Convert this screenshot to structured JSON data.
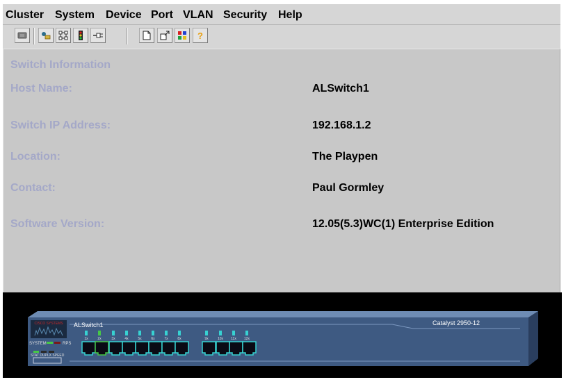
{
  "menu": [
    "Cluster",
    "System",
    "Device",
    "Port",
    "VLAN",
    "Security",
    "Help"
  ],
  "toolbar": {
    "icons": [
      "monitor-icon",
      "topology-icon",
      "network-icon",
      "traffic-light-icon",
      "cable-icon",
      "new-document-icon",
      "move-window-icon",
      "color-grid-icon",
      "help-icon"
    ]
  },
  "switch_info": {
    "title": "Switch Information",
    "host_name_label": "Host Name:",
    "host_name": "ALSwitch1",
    "ip_label": "Switch IP Address:",
    "ip": "192.168.1.2",
    "location_label": "Location:",
    "location": "The Playpen",
    "contact_label": "Contact:",
    "contact": "Paul Gormley",
    "version_label": "Software Version:",
    "version": "12.05(5.3)WC(1) Enterprise Edition"
  },
  "device": {
    "brand": "CISCO SYSTEMS",
    "host": "ALSwitch1",
    "model": "Catalyst 2950-12",
    "system_label": "SYSTEM",
    "rps_label": "RPS",
    "mode_labels": "STAT DUPLX SPEED",
    "port_labels": [
      "1x",
      "2x",
      "3x",
      "4x",
      "5x",
      "6x",
      "7x",
      "8x",
      "9x",
      "10x",
      "11x",
      "12x"
    ],
    "colors": {
      "port_led": "#37d2d2",
      "port_led_active": "#46c846",
      "chassis": "#3e5a82",
      "brand_red": "#c82828"
    }
  }
}
